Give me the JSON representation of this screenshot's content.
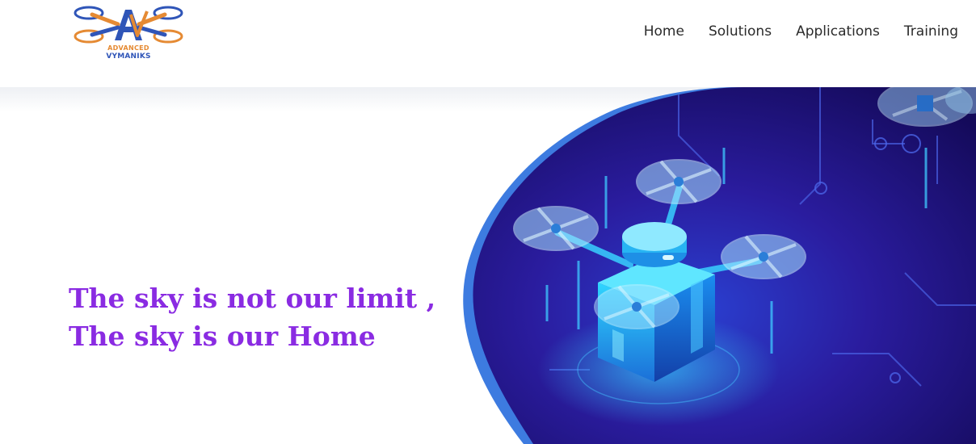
{
  "brand": {
    "logo_line1": "ADVANCED",
    "logo_line2": "VYMANIKS",
    "logo_icon": "drone-logo-icon",
    "colors": {
      "orange": "#e58a33",
      "blue": "#2f55b8"
    }
  },
  "nav": {
    "items": [
      {
        "label": "Home"
      },
      {
        "label": "Solutions"
      },
      {
        "label": "Applications"
      },
      {
        "label": "Training"
      }
    ]
  },
  "hero": {
    "line1": "The sky is not our limit ,",
    "line2": "The sky is our Home",
    "headline_color": "#8a2be2",
    "illustration": "isometric-drone-illustration",
    "colors": {
      "deep": "#1a0f6e",
      "mid": "#3a2cb8",
      "edge": "#3d7be0",
      "cyan": "#35d6ff"
    }
  }
}
